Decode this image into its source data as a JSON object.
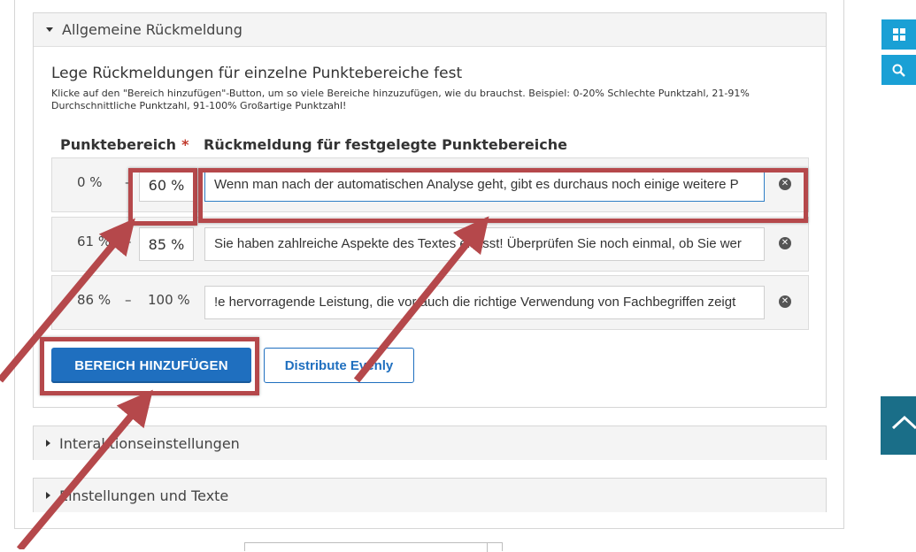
{
  "sections": {
    "general_feedback": {
      "title": "Allgemeine Rückmeldung"
    },
    "interaction_settings": {
      "title": "Interaktionseinstellungen"
    },
    "settings_texts": {
      "title": "Einstellungen und Texte"
    }
  },
  "feedback": {
    "heading": "Lege Rückmeldungen für einzelne Punktebereiche fest",
    "description": "Klicke auf den \"Bereich hinzufügen\"-Button, um so viele Bereiche hinzuzufügen, wie du brauchst. Beispiel: 0-20% Schlechte Punktzahl, 21-91% Durchschnittliche Punktzahl, 91-100% Großartige Punktzahl!",
    "col_range": "Punktebereich",
    "col_range_required": "*",
    "col_feedback": "Rückmeldung für festgelegte Punktebereiche",
    "dash": "–",
    "remove_symbol": "✕",
    "ranges": [
      {
        "from": "0 %",
        "to": "60 %",
        "text": "Wenn man nach der automatischen Analyse geht, gibt es durchaus noch einige weitere P"
      },
      {
        "from": "61 %",
        "to": "85 %",
        "text": "Sie haben zahlreiche Aspekte des Textes erfasst! Überprüfen Sie noch einmal, ob Sie wer"
      },
      {
        "from": "86 %",
        "to": "100 %",
        "text": "e hervorragende Leistung, die vor auch die richtige Verwendung von Fachbegriffen zeigt!"
      }
    ],
    "add_button": "BEREICH HINZUFÜGEN",
    "distribute_button": "Distribute Evenly"
  },
  "annotation_color": "#b5484b",
  "accent_color": "#1f6fbf",
  "side_toolbar": {
    "grid_icon": "grid-icon",
    "search_icon": "search-icon",
    "scroll_top_icon": "chevron-up-icon"
  }
}
